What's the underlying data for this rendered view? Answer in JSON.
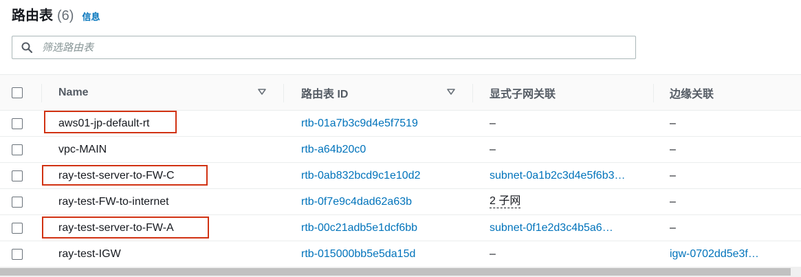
{
  "header": {
    "title": "路由表",
    "count": "(6)",
    "info": "信息"
  },
  "search": {
    "placeholder": "筛选路由表"
  },
  "columns": {
    "name": "Name",
    "rtb_id": "路由表 ID",
    "explicit_subnet": "显式子网关联",
    "edge": "边缘关联"
  },
  "rows": [
    {
      "name": "aws01-jp-default-rt",
      "rtb": "rtb-01a7b3c9d4e5f7519",
      "subnet": "–",
      "edge": "–"
    },
    {
      "name": "vpc-MAIN",
      "rtb": "rtb-a64b20c0",
      "subnet": "–",
      "edge": "–"
    },
    {
      "name": "ray-test-server-to-FW-C",
      "rtb": "rtb-0ab832bcd9c1e10d2",
      "subnet": "subnet-0a1b2c3d4e5f6b3…",
      "edge": "–"
    },
    {
      "name": "ray-test-FW-to-internet",
      "rtb": "rtb-0f7e9c4dad62a63b",
      "subnet": "2 子网",
      "edge": "–"
    },
    {
      "name": "ray-test-server-to-FW-A",
      "rtb": "rtb-00c21adb5e1dcf6bb",
      "subnet": "subnet-0f1e2d3c4b5a6…",
      "edge": "–"
    },
    {
      "name": "ray-test-IGW",
      "rtb": "rtb-015000bb5e5da15d",
      "subnet": "–",
      "edge": "igw-0702dd5e3f…"
    }
  ],
  "colors": {
    "link": "#0073bb",
    "highlight": "#d13212"
  }
}
